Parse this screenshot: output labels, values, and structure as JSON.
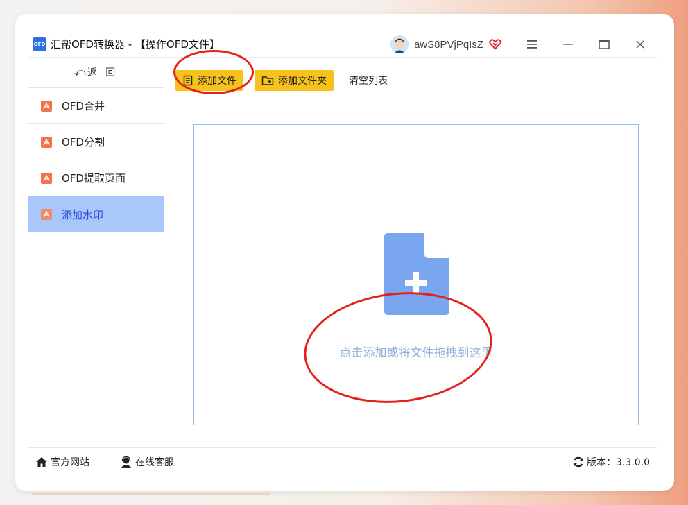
{
  "window": {
    "title": "汇帮OFD转换器 - 【操作OFD文件】",
    "logo_text": "OFD",
    "username": "awS8PVjPqIsZ"
  },
  "sidebar": {
    "back_label": "返 回",
    "items": [
      {
        "label": "OFD合并",
        "active": false
      },
      {
        "label": "OFD分割",
        "active": false
      },
      {
        "label": "OFD提取页面",
        "active": false
      },
      {
        "label": "添加水印",
        "active": true
      }
    ]
  },
  "toolbar": {
    "add_file": "添加文件",
    "add_folder": "添加文件夹",
    "clear_list": "清空列表"
  },
  "dropzone": {
    "hint": "点击添加或将文件拖拽到这里"
  },
  "footer": {
    "website": "官方网站",
    "service": "在线客服",
    "version": "版本：3.3.0.0"
  },
  "colors": {
    "accent_yellow": "#f7c21b",
    "active_nav": "#a9c7fb",
    "pdf_icon": "#f0754f",
    "dropzone_icon": "#7aa6ef",
    "annotation": "#e3231b"
  }
}
